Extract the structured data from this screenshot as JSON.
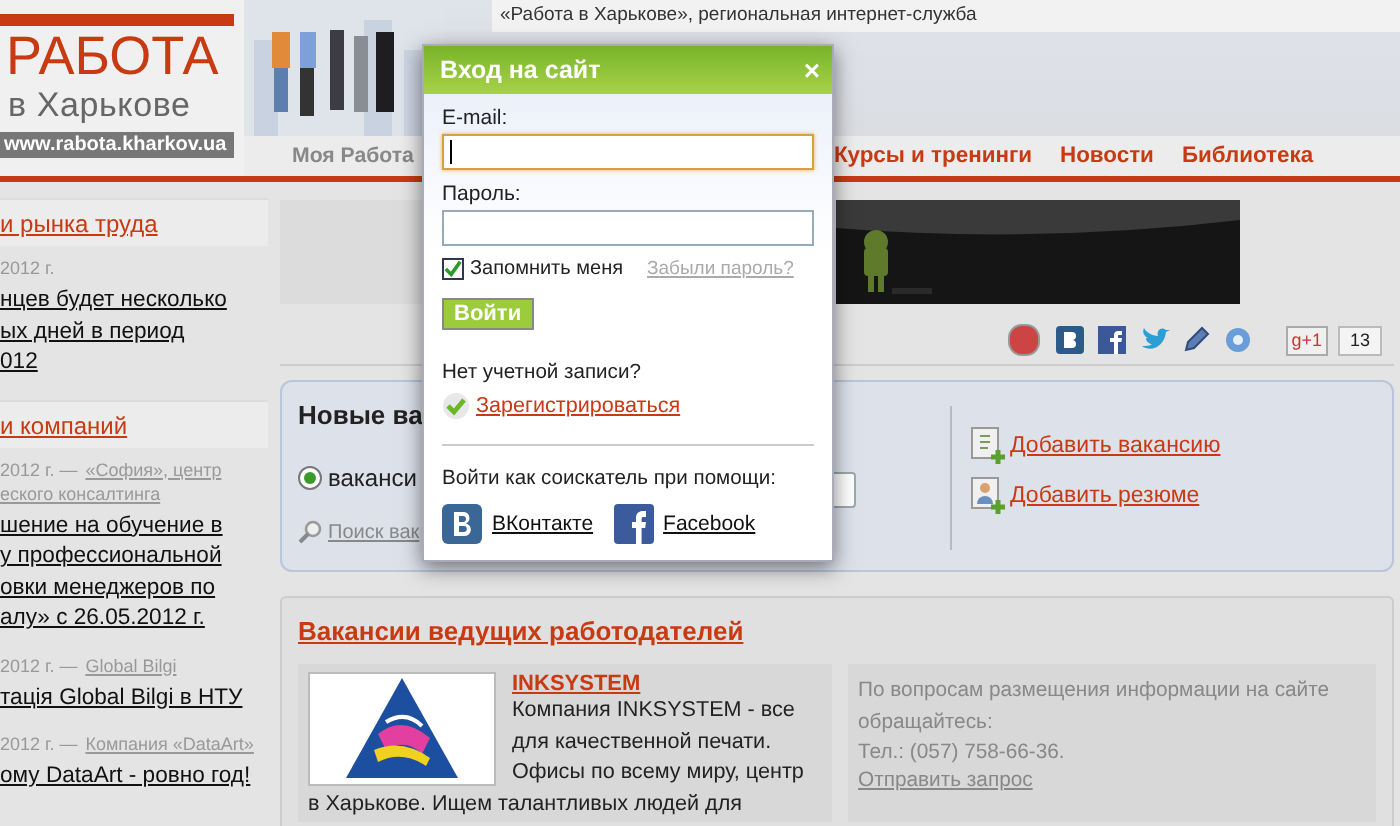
{
  "top_strip": {
    "text": "«Работа в Харькове», региональная интернет-служба"
  },
  "logo": {
    "title": "РАБОТА",
    "subtitle": "в Харькове",
    "url": "www.rabota.kharkov.ua"
  },
  "nav": [
    {
      "label": "Моя Работа",
      "selected": true
    },
    {
      "label": "Курсы и тренинги",
      "selected": false
    },
    {
      "label": "Новости",
      "selected": false
    },
    {
      "label": "Библиотека",
      "selected": false
    }
  ],
  "sidebar": [
    {
      "heading": "и рынка труда",
      "items": [
        {
          "date": "2012 г.",
          "title_lines": [
            "нцев будет несколько",
            "ых дней в период",
            "012"
          ]
        }
      ]
    },
    {
      "heading": "и компаний",
      "items": [
        {
          "date": "2012 г. —",
          "source_lines": [
            "«София», центр",
            "еского консалтинга"
          ],
          "title_lines": [
            "шение на обучение в",
            "у профессиональной",
            "овки менеджеров по",
            "алу» с 26.05.2012 г."
          ]
        },
        {
          "date": "2012 г. —",
          "source_lines": [
            "Global Bilgi"
          ],
          "title_lines": [
            "тація Global Bilgi в НТУ"
          ]
        },
        {
          "date": "2012 г. —",
          "source_lines": [
            "Компания «DataArt»"
          ],
          "title_lines": [
            "ому DataArt - ровно год!"
          ]
        }
      ]
    }
  ],
  "share": {
    "plus_label": "g+1",
    "count": "13"
  },
  "search_panel": {
    "title": "Новые ва",
    "radio": {
      "label": "ваканси",
      "selected": true
    },
    "search_link": "Поиск вак",
    "actions": [
      {
        "kind": "vacancy",
        "label": "Добавить вакансию"
      },
      {
        "kind": "resume",
        "label": "Добавить резюме"
      }
    ]
  },
  "employers": {
    "title": "Вакансии ведущих работодателей",
    "company": {
      "name": "INKSYSTEM",
      "description_side": "Компания INKSYSTEM - все для качественной печати. Офисы по всему миру, центр",
      "description_below": "в Харькове. Ищем талантливых людей для"
    },
    "contact": {
      "text": "По вопросам размещения информации на сайте обращайтесь:",
      "phone": "Тел.: (057) 758-66-36.",
      "link": "Отправить запрос"
    }
  },
  "login": {
    "title": "Вход на сайт",
    "close": "×",
    "email_label": "E-mail:",
    "email_focused": true,
    "password_label": "Пароль:",
    "remember": {
      "label": "Запомнить меня",
      "checked": true
    },
    "forgot": "Забыли пароль?",
    "submit": "Войти",
    "no_account": "Нет учетной записи?",
    "register": "Зарегистрироваться",
    "social_prompt": "Войти как соискатель при помощи:",
    "social": [
      {
        "kind": "vk",
        "label": "ВКонтакте"
      },
      {
        "kind": "facebook",
        "label": "Facebook"
      }
    ]
  }
}
